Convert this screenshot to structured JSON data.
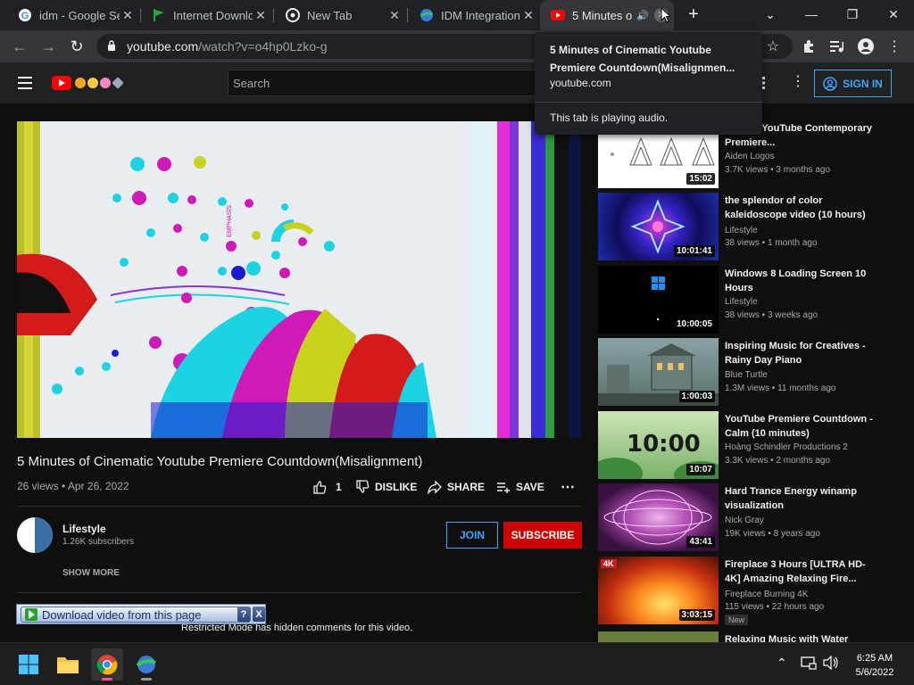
{
  "browser": {
    "tabs": [
      {
        "title": "idm - Google Se"
      },
      {
        "title": "Internet Downlo"
      },
      {
        "title": "New Tab"
      },
      {
        "title": "IDM Integration"
      },
      {
        "title": "5 Minutes o"
      }
    ],
    "url_host": "youtube.com",
    "url_path": "/watch?v=o4hp0Lzko-g"
  },
  "tooltip": {
    "title": "5 Minutes of Cinematic Youtube Premiere Countdown(Misalignmen...",
    "domain": "youtube.com",
    "audio_note": "This tab is playing audio."
  },
  "youtube": {
    "search_placeholder": "Search",
    "signin_label": "SIGN IN"
  },
  "video": {
    "title": "5 Minutes of Cinematic Youtube Premiere Countdown(Misalignment)",
    "meta": "26 views • Apr 26, 2022",
    "like_count": "1",
    "dislike_label": "DISLIKE",
    "share_label": "SHARE",
    "save_label": "SAVE"
  },
  "channel": {
    "name": "Lifestyle",
    "subscribers": "1.26K subscribers",
    "join_label": "JOIN",
    "subscribe_label": "SUBSCRIBE",
    "show_more": "SHOW MORE"
  },
  "restricted_note": "Restricted Mode has hidden comments for this video.",
  "idm": {
    "download_label": "Download video from this page",
    "help_label": "?",
    "close_label": "X"
  },
  "sidebar": {
    "items": [
      {
        "title": "...tes of YouTube Contemporary Premiere...",
        "channel": "Aiden Logos",
        "views": "3.7K views • 3 months ago",
        "duration": "15:02",
        "badge": ""
      },
      {
        "title": "the splendor of color kaleidoscope video (10 hours)",
        "channel": "Lifestyle",
        "views": "38 views • 1 month ago",
        "duration": "10:01:41",
        "badge": ""
      },
      {
        "title": "Windows 8 Loading Screen 10 Hours",
        "channel": "Lifestyle",
        "views": "38 views • 3 weeks ago",
        "duration": "10:00:05",
        "badge": ""
      },
      {
        "title": "Inspiring Music for Creatives - Rainy Day Piano",
        "channel": "Blue Turtle",
        "views": "1.3M views • 11 months ago",
        "duration": "1:00:03",
        "badge": ""
      },
      {
        "title": "YouTube Premiere Countdown - Calm (10 minutes)",
        "channel": "Hoàng Schindler Productions 2",
        "views": "3.3K views • 2 months ago",
        "duration": "10:07",
        "badge": "",
        "thumb_text": "10:00"
      },
      {
        "title": "Hard Trance Energy winamp visualization",
        "channel": "Nick Gray",
        "views": "19K views • 8 years ago",
        "duration": "43:41",
        "badge": ""
      },
      {
        "title": "Fireplace 3 Hours [ULTRA HD-4K] Amazing Relaxing Fire...",
        "channel": "Fireplace Burning 4K",
        "views": "115 views • 22 hours ago",
        "duration": "3:03:15",
        "badge": "New",
        "thumb_text": "4K"
      },
      {
        "title": "Relaxing Music with Water",
        "channel": "",
        "views": "",
        "duration": "",
        "badge": ""
      }
    ]
  },
  "taskbar": {
    "time": "6:25 AM",
    "date": "5/6/2022"
  },
  "colors": {
    "yt_red": "#ff0000",
    "subscribe_red": "#cc0000",
    "link_blue": "#3ea6ff",
    "page_bg": "#0f0f0f"
  }
}
